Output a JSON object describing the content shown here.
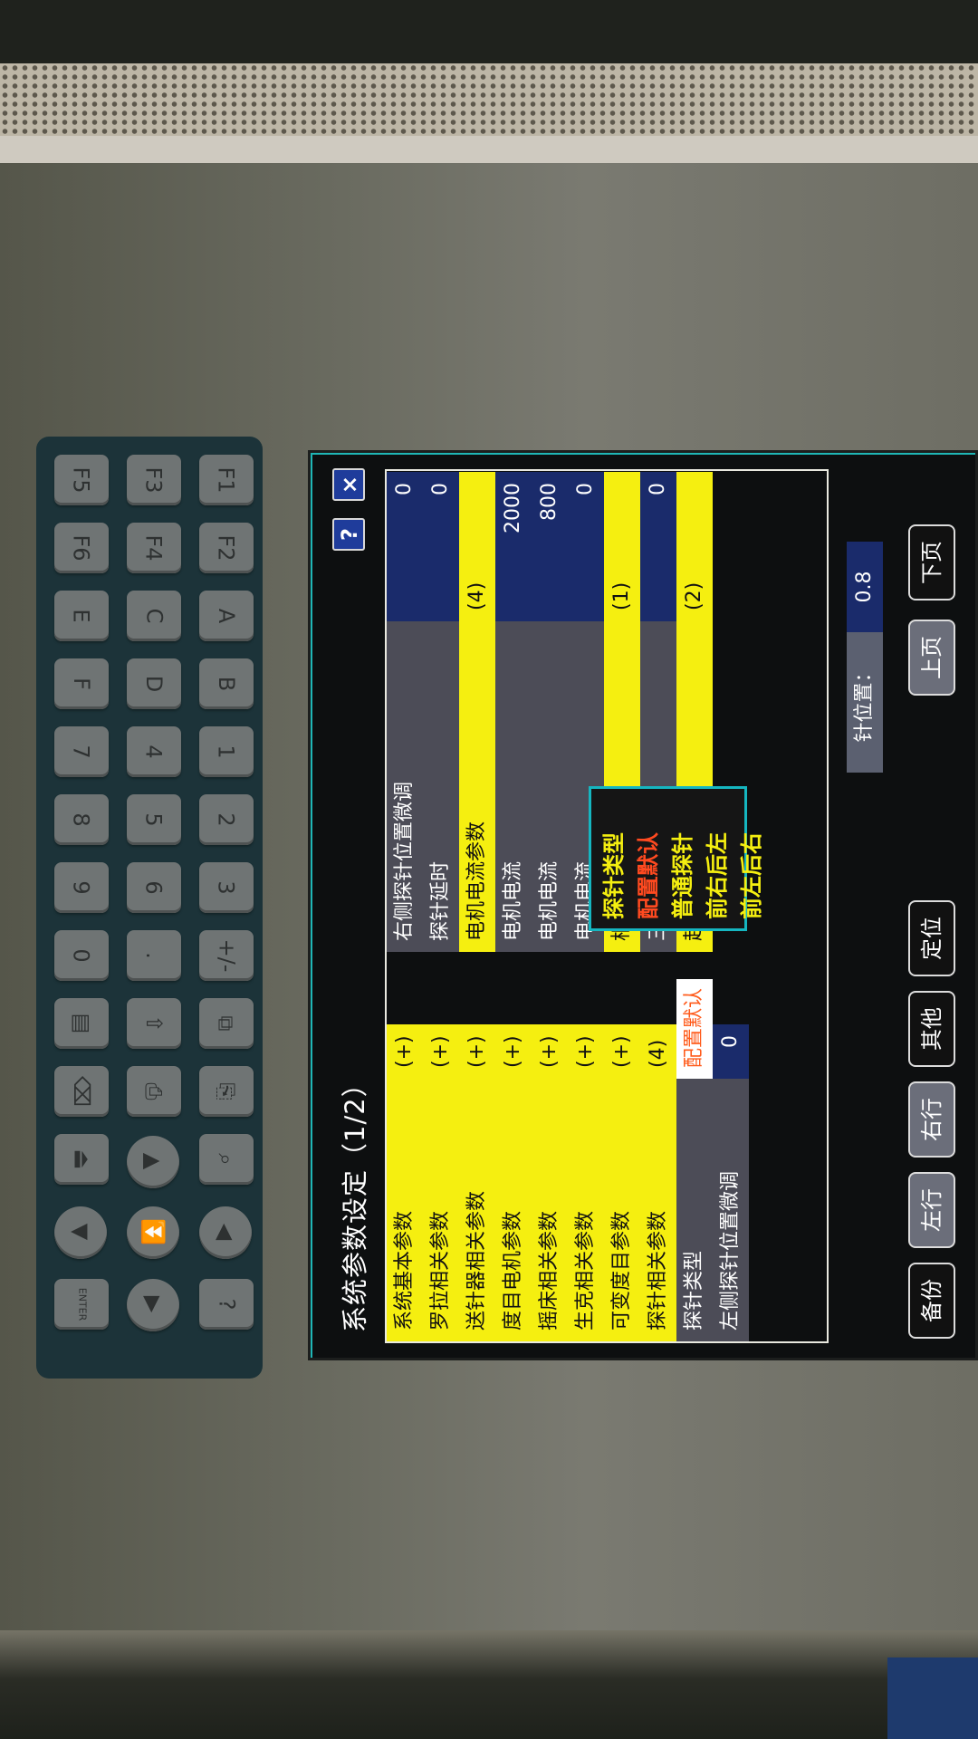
{
  "screen": {
    "title": "系统参数设定（1/2）",
    "help_label": "?",
    "close_label": "×",
    "left_column": [
      {
        "label": "系统基本参数",
        "value": "(+)"
      },
      {
        "label": "罗拉相关参数",
        "value": "(+)"
      },
      {
        "label": "送针器相关参数",
        "value": "(+)"
      },
      {
        "label": "度目电机参数",
        "value": "(+)"
      },
      {
        "label": "摇床相关参数",
        "value": "(+)"
      },
      {
        "label": "生克相关参数",
        "value": "(+)"
      },
      {
        "label": "可变度目参数",
        "value": "(+)"
      },
      {
        "label": "探针相关参数",
        "value": "(4)"
      },
      {
        "label": "探针类型",
        "value": "配置默认"
      },
      {
        "label": "左侧探针位置微调",
        "value": "0"
      }
    ],
    "right_column": [
      {
        "label": "右侧探针位置微调",
        "value": "0"
      },
      {
        "label": "探针延时",
        "value": "0"
      },
      {
        "label": "电机电流参数",
        "value": "(4)"
      },
      {
        "label": "电机电流",
        "value": "2000"
      },
      {
        "label": "电机电流",
        "value": "800"
      },
      {
        "label": "电机电流",
        "value": "0"
      },
      {
        "label": "相关参数",
        "value": "(1)"
      },
      {
        "label": "三角电机速度",
        "value": "0"
      },
      {
        "label": "起底板相关参数",
        "value": "(2)"
      }
    ],
    "popup": {
      "title": "探针类型",
      "options": [
        "配置默认",
        "普通探针",
        "前右后左",
        "前左后右"
      ]
    },
    "needle_position": {
      "label": "针位置：",
      "value": "0.8"
    },
    "buttons": {
      "backup": "备份",
      "left_row": "左行",
      "right_row": "右行",
      "other": "其他",
      "locate": "定位",
      "prev_page": "上页",
      "next_page": "下页"
    }
  },
  "keypad": {
    "keys": [
      "F1",
      "F2",
      "A",
      "B",
      "1",
      "2",
      "3",
      "+/-",
      "F3",
      "F4",
      "C",
      "D",
      "4",
      "5",
      "6",
      ".",
      "F5",
      "F6",
      "E",
      "F",
      "7",
      "8",
      "9",
      "0",
      "ENTER",
      "?"
    ]
  },
  "colors": {
    "highlight_yellow": "#f5ef10",
    "value_navy": "#1a2b6b",
    "label_gray": "#4c4c57",
    "popup_border": "#15b6c0",
    "selected_text": "#ff4a20"
  }
}
